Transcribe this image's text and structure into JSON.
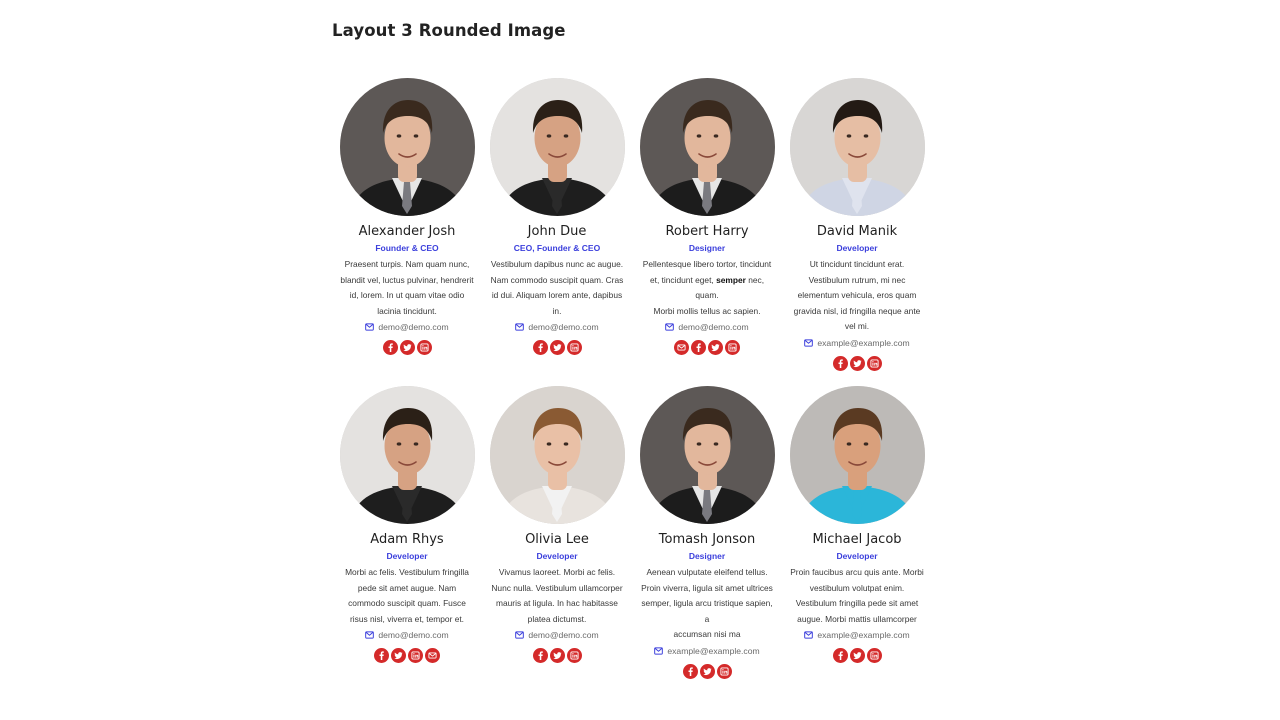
{
  "page": {
    "title": "Layout 3 Rounded Image"
  },
  "colors": {
    "accent": "#3b3fdc",
    "social": "#d42a2a"
  },
  "members": [
    {
      "name": "Alexander Josh",
      "role": "Founder & CEO",
      "desc": [
        "Praesent turpis. Nam quam nunc,",
        "blandit vel, luctus pulvinar, hendrerit",
        "id, lorem. In ut quam vitae odio",
        "lacinia tincidunt."
      ],
      "email": "demo@demo.com",
      "socials": [
        "facebook-icon",
        "twitter-icon",
        "linkedin-icon"
      ],
      "photo": {
        "bg": "#5d5856",
        "skin": "#e2b79c",
        "hair": "#3a2a1e",
        "shirt": "#e6e6e6",
        "jacket": "#1c1c1c",
        "tie": "#7a7a80"
      }
    },
    {
      "name": "John Due",
      "role": "CEO, Founder & CEO",
      "desc": [
        "Vestibulum dapibus nunc ac augue.",
        "Nam commodo suscipit quam. Cras",
        "id dui. Aliquam lorem ante, dapibus",
        "in."
      ],
      "email": "demo@demo.com",
      "socials": [
        "facebook-icon",
        "twitter-icon",
        "linkedin-icon"
      ],
      "photo": {
        "bg": "#e4e2e0",
        "skin": "#d6a283",
        "hair": "#2b2017",
        "shirt": "#2a2a2a",
        "jacket": "#1e1e1e",
        "tie": "#2a2a2a"
      }
    },
    {
      "name": "Robert Harry",
      "role": "Designer",
      "desc": [
        "Pellentesque libero tortor, tincidunt",
        "et, tincidunt eget, |semper| nec, quam.",
        "Morbi mollis tellus ac sapien."
      ],
      "email": "demo@demo.com",
      "socials": [
        "mail-icon",
        "facebook-icon",
        "twitter-icon",
        "linkedin-icon"
      ],
      "photo": {
        "bg": "#5d5856",
        "skin": "#e2b79c",
        "hair": "#3a2a1e",
        "shirt": "#e6e6e6",
        "jacket": "#1c1c1c",
        "tie": "#7a7a80"
      }
    },
    {
      "name": "David Manik",
      "role": "Developer",
      "desc": [
        "Ut tincidunt tincidunt erat.",
        "Vestibulum rutrum, mi nec",
        "elementum vehicula, eros quam",
        "gravida nisl, id fringilla neque ante",
        "vel mi."
      ],
      "email": "example@example.com",
      "socials": [
        "facebook-icon",
        "twitter-icon",
        "linkedin-icon"
      ],
      "photo": {
        "bg": "#d8d6d4",
        "skin": "#e6bea4",
        "hair": "#231a14",
        "shirt": "#dfe3ee",
        "jacket": "#cfd5e4",
        "tie": "#dfe3ee"
      }
    },
    {
      "name": "Adam Rhys",
      "role": "Developer",
      "desc": [
        "Morbi ac felis. Vestibulum fringilla",
        "pede sit amet augue. Nam",
        "commodo suscipit quam. Fusce",
        "risus nisl, viverra et, tempor et."
      ],
      "email": "demo@demo.com",
      "socials": [
        "facebook-icon",
        "twitter-icon",
        "linkedin-icon",
        "mail-icon"
      ],
      "photo": {
        "bg": "#e4e2e0",
        "skin": "#d6a283",
        "hair": "#2b2017",
        "shirt": "#2a2a2a",
        "jacket": "#1e1e1e",
        "tie": "#2a2a2a"
      }
    },
    {
      "name": "Olivia Lee",
      "role": "Developer",
      "desc": [
        "Vivamus laoreet. Morbi ac felis.",
        "Nunc nulla. Vestibulum ullamcorper",
        "mauris at ligula. In hac habitasse",
        "platea dictumst."
      ],
      "email": "demo@demo.com",
      "socials": [
        "facebook-icon",
        "twitter-icon",
        "linkedin-icon"
      ],
      "photo": {
        "bg": "#d9d4cf",
        "skin": "#e9c0a6",
        "hair": "#8a5a33",
        "shirt": "#f2f2f2",
        "jacket": "#e8e3de",
        "tie": "#f2f2f2"
      }
    },
    {
      "name": "Tomash Jonson",
      "role": "Designer",
      "desc": [
        "Aenean vulputate eleifend tellus.",
        "Proin viverra, ligula sit amet ultrices",
        "semper, ligula arcu tristique sapien, a",
        "accumsan nisi ma"
      ],
      "email": "example@example.com",
      "socials": [
        "facebook-icon",
        "twitter-icon",
        "linkedin-icon"
      ],
      "photo": {
        "bg": "#5d5856",
        "skin": "#e2b79c",
        "hair": "#3a2a1e",
        "shirt": "#e6e6e6",
        "jacket": "#1c1c1c",
        "tie": "#7a7a80"
      }
    },
    {
      "name": "Michael Jacob",
      "role": "Developer",
      "desc": [
        "Proin faucibus arcu quis ante. Morbi",
        "vestibulum volutpat enim.",
        "Vestibulum fringilla pede sit amet",
        "augue. Morbi mattis ullamcorper"
      ],
      "email": "example@example.com",
      "socials": [
        "facebook-icon",
        "twitter-icon",
        "linkedin-icon"
      ],
      "photo": {
        "bg": "#bdbab7",
        "skin": "#d9a07c",
        "hair": "#5a3a22",
        "shirt": "#2bb6d9",
        "jacket": "#2bb6d9",
        "tie": "#2bb6d9"
      }
    }
  ]
}
